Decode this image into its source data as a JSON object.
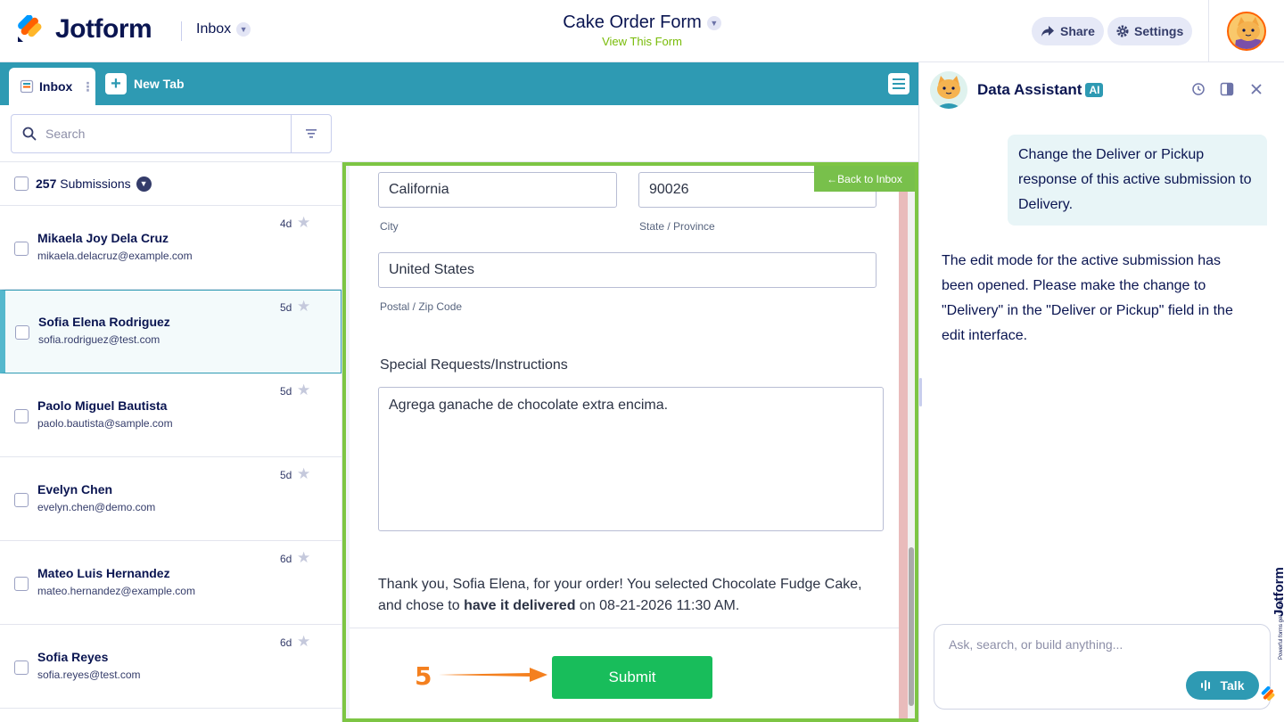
{
  "header": {
    "brand": "Jotform",
    "inbox_label": "Inbox",
    "form_title": "Cake Order Form",
    "view_form": "View This Form",
    "share_label": "Share",
    "settings_label": "Settings"
  },
  "tabs": {
    "inbox_tab": "Inbox",
    "new_tab": "New Tab"
  },
  "search": {
    "placeholder": "Search"
  },
  "list": {
    "count": "257",
    "count_suffix": " Submissions",
    "items": [
      {
        "name": "Mikaela Joy Dela Cruz",
        "email": "mikaela.delacruz@example.com",
        "date": "4d"
      },
      {
        "name": "Sofia Elena Rodriguez",
        "email": "sofia.rodriguez@test.com",
        "date": "5d"
      },
      {
        "name": "Paolo Miguel Bautista",
        "email": "paolo.bautista@sample.com",
        "date": "5d"
      },
      {
        "name": "Evelyn Chen",
        "email": "evelyn.chen@demo.com",
        "date": "5d"
      },
      {
        "name": "Mateo Luis Hernandez",
        "email": "mateo.hernandez@example.com",
        "date": "6d"
      },
      {
        "name": "Sofia Reyes",
        "email": "sofia.reyes@test.com",
        "date": "6d"
      }
    ]
  },
  "form": {
    "back_to_inbox": "←Back to Inbox",
    "city_value": "California",
    "state_value": "90026",
    "city_label": "City",
    "state_label": "State / Province",
    "zip_value": "United States",
    "zip_label": "Postal / Zip Code",
    "special_label": "Special Requests/Instructions",
    "special_value": "Agrega ganache de chocolate extra encima.",
    "thanks_pre": "Thank you, Sofia Elena, for your order! You selected Chocolate Fudge Cake, and chose to ",
    "thanks_bold": "have it delivered",
    "thanks_post": " on 08-21-2026 11:30 AM.",
    "submit_label": "Submit",
    "step_number": "5"
  },
  "assistant": {
    "title": "Data Assistant",
    "badge": "AI",
    "user_message": "Change the Deliver or Pickup response of this active submission to Delivery.",
    "ai_message": "The edit mode for the active submission has been opened. Please make the change to \"Delivery\" in the \"Deliver or Pickup\" field in the edit interface.",
    "input_placeholder": "Ask, search, or build anything...",
    "talk_label": "Talk",
    "watermark": "Jotform",
    "watermark_sub": "Powerful forms get it done"
  },
  "colors": {
    "accent": "#2e9ab3",
    "form_border": "#7dc544",
    "submit": "#18bd5b",
    "step_orange": "#f4801f"
  }
}
